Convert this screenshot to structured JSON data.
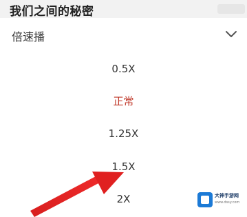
{
  "header": {
    "title": "我们之间的秘密"
  },
  "speed_panel": {
    "title": "倍速播",
    "collapse_icon": "chevron-down-icon",
    "options": [
      {
        "label": "0.5X",
        "selected": false
      },
      {
        "label": "正常",
        "selected": true
      },
      {
        "label": "1.25X",
        "selected": false
      },
      {
        "label": "1.5X",
        "selected": false
      },
      {
        "label": "2X",
        "selected": false
      }
    ]
  },
  "annotation": {
    "arrow_color": "#e02020",
    "target": "1.5X"
  },
  "colors": {
    "selected": "#c0392b",
    "text": "#333333",
    "watermark_blue": "#1c7ad6"
  },
  "watermark": {
    "name": "大神手游网",
    "url": "www.dssy.com"
  }
}
